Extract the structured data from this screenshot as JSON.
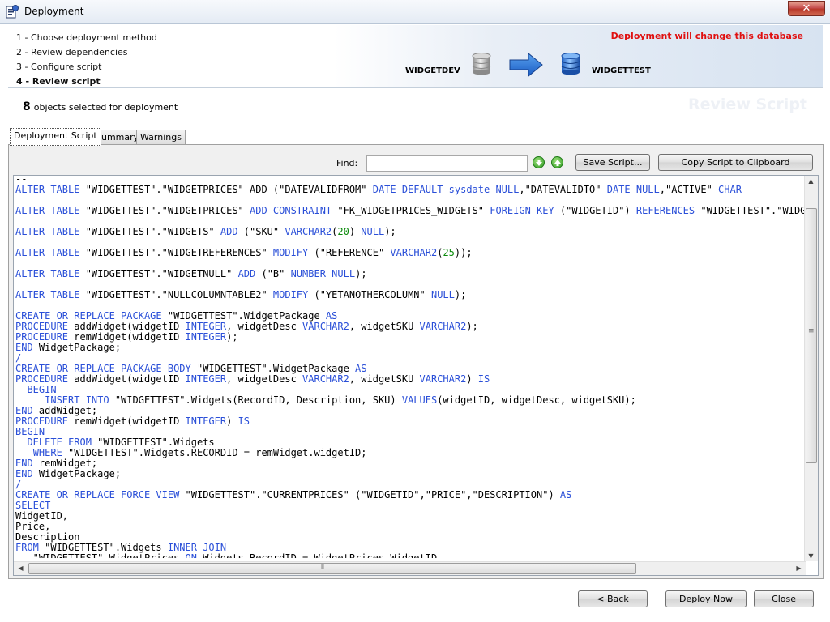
{
  "window": {
    "title": "Deployment",
    "close_label": "✕"
  },
  "header": {
    "steps": [
      "1 - Choose deployment method",
      "2 - Review dependencies",
      "3 - Configure script",
      "4 - Review script"
    ],
    "active_step": 3,
    "warning": "Deployment will change this database",
    "source_db": "WIDGETDEV",
    "target_db": "WIDGETTEST"
  },
  "selection": {
    "count": "8",
    "text": "objects selected for deployment"
  },
  "page_heading": "Review Script",
  "tabs": [
    {
      "label": "Deployment Script",
      "active": true
    },
    {
      "label": "Summary",
      "active": false
    },
    {
      "label": "Warnings",
      "active": false
    }
  ],
  "toolbar": {
    "find_label": "Find:",
    "find_value": "",
    "save_label": "Save Script...",
    "copy_label": "Copy Script to Clipboard"
  },
  "script_lines": [
    [
      [
        "--",
        ""
      ]
    ],
    [
      [
        "ALTER TABLE",
        "k"
      ],
      [
        " \"WIDGETTEST\".\"WIDGETPRICES\" ",
        ""
      ],
      [
        "ADD",
        ""
      ],
      [
        " (\"DATEVALIDFROM\" ",
        ""
      ],
      [
        "DATE DEFAULT sysdate NULL",
        "k"
      ],
      [
        ",\"DATEVALIDTO\" ",
        ""
      ],
      [
        "DATE NULL",
        "k"
      ],
      [
        ",\"ACTIVE\" ",
        ""
      ],
      [
        "CHAR",
        "k"
      ]
    ],
    [],
    [
      [
        "ALTER TABLE",
        "k"
      ],
      [
        " \"WIDGETTEST\".\"WIDGETPRICES\" ",
        ""
      ],
      [
        "ADD CONSTRAINT",
        "k"
      ],
      [
        " \"FK_WIDGETPRICES_WIDGETS\" ",
        ""
      ],
      [
        "FOREIGN KEY",
        "k"
      ],
      [
        " (\"WIDGETID\") ",
        ""
      ],
      [
        "REFERENCES",
        "k"
      ],
      [
        " \"WIDGETTEST\".\"WIDGETS\"",
        ""
      ]
    ],
    [],
    [
      [
        "ALTER TABLE",
        "k"
      ],
      [
        " \"WIDGETTEST\".\"WIDGETS\" ",
        ""
      ],
      [
        "ADD",
        "k"
      ],
      [
        " (\"SKU\" ",
        ""
      ],
      [
        "VARCHAR2",
        "k"
      ],
      [
        "(",
        ""
      ],
      [
        "20",
        "n"
      ],
      [
        ") ",
        ""
      ],
      [
        "NULL",
        "k"
      ],
      [
        ");",
        ""
      ]
    ],
    [],
    [
      [
        "ALTER TABLE",
        "k"
      ],
      [
        " \"WIDGETTEST\".\"WIDGETREFERENCES\" ",
        ""
      ],
      [
        "MODIFY",
        "k"
      ],
      [
        " (\"REFERENCE\" ",
        ""
      ],
      [
        "VARCHAR2",
        "k"
      ],
      [
        "(",
        ""
      ],
      [
        "25",
        "n"
      ],
      [
        "));",
        ""
      ]
    ],
    [],
    [
      [
        "ALTER TABLE",
        "k"
      ],
      [
        " \"WIDGETTEST\".\"WIDGETNULL\" ",
        ""
      ],
      [
        "ADD",
        "k"
      ],
      [
        " (\"B\" ",
        ""
      ],
      [
        "NUMBER NULL",
        "k"
      ],
      [
        ");",
        ""
      ]
    ],
    [],
    [
      [
        "ALTER TABLE",
        "k"
      ],
      [
        " \"WIDGETTEST\".\"NULLCOLUMNTABLE2\" ",
        ""
      ],
      [
        "MODIFY",
        "k"
      ],
      [
        " (\"YETANOTHERCOLUMN\" ",
        ""
      ],
      [
        "NULL",
        "k"
      ],
      [
        ");",
        ""
      ]
    ],
    [],
    [
      [
        "CREATE OR REPLACE PACKAGE",
        "k"
      ],
      [
        " \"WIDGETTEST\".WidgetPackage ",
        ""
      ],
      [
        "AS",
        "k"
      ]
    ],
    [
      [
        "PROCEDURE",
        "k"
      ],
      [
        " addWidget(widgetID ",
        ""
      ],
      [
        "INTEGER",
        "k"
      ],
      [
        ", widgetDesc ",
        ""
      ],
      [
        "VARCHAR2",
        "k"
      ],
      [
        ", widgetSKU ",
        ""
      ],
      [
        "VARCHAR2",
        "k"
      ],
      [
        ");",
        ""
      ]
    ],
    [
      [
        "PROCEDURE",
        "k"
      ],
      [
        " remWidget(widgetID ",
        ""
      ],
      [
        "INTEGER",
        "k"
      ],
      [
        ");",
        ""
      ]
    ],
    [
      [
        "END",
        "k"
      ],
      [
        " WidgetPackage;",
        ""
      ]
    ],
    [
      [
        "/",
        "k"
      ]
    ],
    [
      [
        "CREATE OR REPLACE PACKAGE BODY",
        "k"
      ],
      [
        " \"WIDGETTEST\".WidgetPackage ",
        ""
      ],
      [
        "AS",
        "k"
      ]
    ],
    [
      [
        "PROCEDURE",
        "k"
      ],
      [
        " addWidget(widgetID ",
        ""
      ],
      [
        "INTEGER",
        "k"
      ],
      [
        ", widgetDesc ",
        ""
      ],
      [
        "VARCHAR2",
        "k"
      ],
      [
        ", widgetSKU ",
        ""
      ],
      [
        "VARCHAR2",
        "k"
      ],
      [
        ") ",
        ""
      ],
      [
        "IS",
        "k"
      ]
    ],
    [
      [
        "  ",
        ""
      ],
      [
        "BEGIN",
        "k"
      ]
    ],
    [
      [
        "     ",
        ""
      ],
      [
        "INSERT INTO",
        "k"
      ],
      [
        " \"WIDGETTEST\".Widgets(RecordID, Description, SKU) ",
        ""
      ],
      [
        "VALUES",
        "k"
      ],
      [
        "(widgetID, widgetDesc, widgetSKU);",
        ""
      ]
    ],
    [
      [
        "END",
        "k"
      ],
      [
        " addWidget;",
        ""
      ]
    ],
    [
      [
        "PROCEDURE",
        "k"
      ],
      [
        " remWidget(widgetID ",
        ""
      ],
      [
        "INTEGER",
        "k"
      ],
      [
        ") ",
        ""
      ],
      [
        "IS",
        "k"
      ]
    ],
    [
      [
        "BEGIN",
        "k"
      ]
    ],
    [
      [
        "  ",
        ""
      ],
      [
        "DELETE FROM",
        "k"
      ],
      [
        " \"WIDGETTEST\".Widgets",
        ""
      ]
    ],
    [
      [
        "   ",
        ""
      ],
      [
        "WHERE",
        "k"
      ],
      [
        " \"WIDGETTEST\".Widgets.RECORDID = remWidget.widgetID;",
        ""
      ]
    ],
    [
      [
        "END",
        "k"
      ],
      [
        " remWidget;",
        ""
      ]
    ],
    [
      [
        "END",
        "k"
      ],
      [
        " WidgetPackage;",
        ""
      ]
    ],
    [
      [
        "/",
        "k"
      ]
    ],
    [
      [
        "CREATE OR REPLACE FORCE VIEW",
        "k"
      ],
      [
        " \"WIDGETTEST\".\"CURRENTPRICES\" (\"WIDGETID\",\"PRICE\",\"DESCRIPTION\") ",
        ""
      ],
      [
        "AS",
        "k"
      ]
    ],
    [
      [
        "SELECT",
        "k"
      ]
    ],
    [
      [
        "WidgetID,",
        ""
      ]
    ],
    [
      [
        "Price,",
        ""
      ]
    ],
    [
      [
        "Description",
        ""
      ]
    ],
    [
      [
        "FROM",
        "k"
      ],
      [
        " \"WIDGETTEST\".Widgets ",
        ""
      ],
      [
        "INNER JOIN",
        "k"
      ]
    ],
    [
      [
        "   \"WIDGETTEST\".WidgetPrices ",
        ""
      ],
      [
        "ON",
        "k"
      ],
      [
        " Widgets.RecordID = WidgetPrices.WidgetID",
        ""
      ]
    ]
  ],
  "footer": {
    "back_label": "< Back",
    "deploy_label": "Deploy Now",
    "close_label": "Close"
  }
}
